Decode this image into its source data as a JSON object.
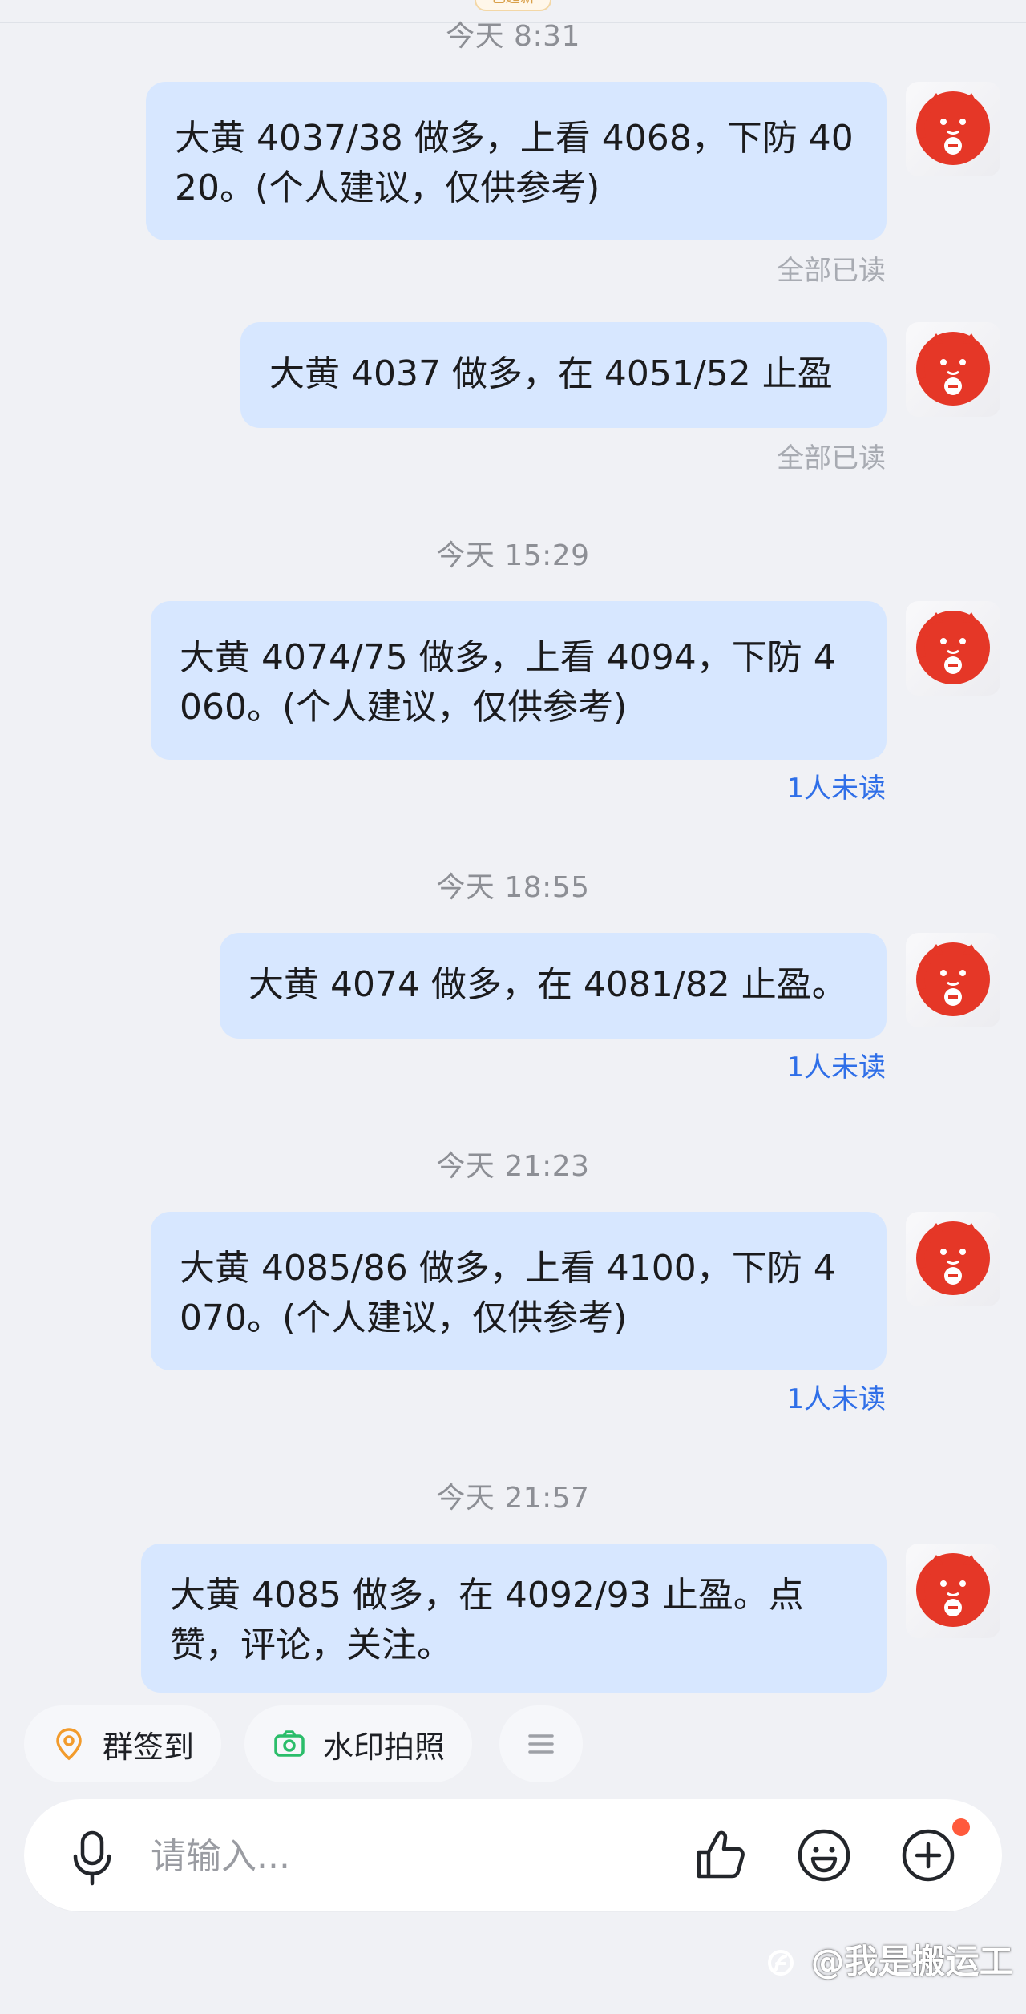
{
  "header": {
    "badge_label": "已超新"
  },
  "messages": [
    {
      "time": "今天 8:31",
      "text": "大黄 4037/38 做多，上看 4068，下防 4020。(个人建议，仅供参考)",
      "status": "全部已读"
    },
    {
      "text": "大黄 4037 做多，在 4051/52 止盈",
      "status": "全部已读"
    },
    {
      "time": "今天 15:29",
      "text": "大黄 4074/75 做多，上看 4094，下防 4060。(个人建议，仅供参考)",
      "status": "1人未读"
    },
    {
      "time": "今天 18:55",
      "text": "大黄 4074 做多，在 4081/82 止盈。",
      "status": "1人未读"
    },
    {
      "time": "今天 21:23",
      "text": "大黄 4085/86 做多，上看 4100，下防 4070。(个人建议，仅供参考)",
      "status": "1人未读"
    },
    {
      "time": "今天 21:57",
      "text": "大黄 4085 做多，在 4092/93 止盈。点赞，评论，关注。"
    }
  ],
  "quick_actions": [
    {
      "label": "群签到",
      "icon": "location-pin-icon",
      "color": "#f29b2b"
    },
    {
      "label": "水印拍照",
      "icon": "camera-icon",
      "color": "#2bbd6a"
    },
    {
      "label": "",
      "icon": "menu-icon"
    }
  ],
  "composer": {
    "placeholder": "请输入...",
    "mic_icon": "microphone-icon",
    "like_icon": "thumbs-up-icon",
    "emoji_icon": "emoji-icon",
    "plus_icon": "plus-circle-icon"
  },
  "watermark": {
    "text": "@我是搬运工"
  },
  "colors": {
    "background": "#f0f1f5",
    "bubble": "#d7e7ff",
    "read_status": "#a8abb2",
    "unread_status": "#2f6fe8",
    "notification_dot": "#ff5a3c"
  }
}
